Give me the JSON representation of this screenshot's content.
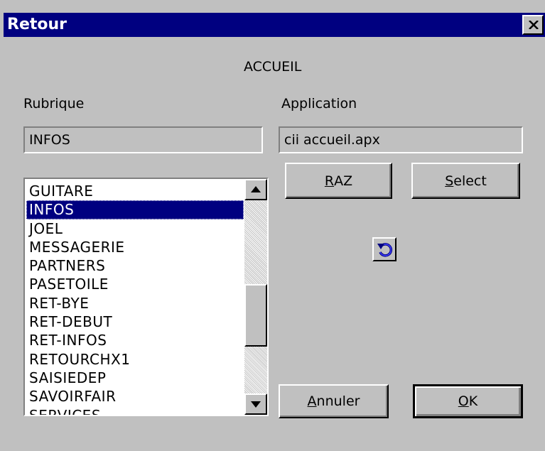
{
  "window": {
    "title": "Retour"
  },
  "heading": "ACCUEIL",
  "labels": {
    "rubrique": "Rubrique",
    "application": "Application"
  },
  "fields": {
    "rubrique_value": "INFOS",
    "application_value": "cii accueil.apx"
  },
  "buttons": {
    "raz": {
      "accel": "R",
      "rest": "AZ"
    },
    "select": {
      "accel": "S",
      "rest": "elect"
    },
    "annuler": {
      "accel": "A",
      "rest": "nnuler"
    },
    "ok": {
      "accel": "O",
      "rest": "K"
    }
  },
  "list": {
    "items": [
      "GUITARE",
      "INFOS",
      "JOEL",
      "MESSAGERIE",
      "PARTNERS",
      "PASETOILE",
      "RET-BYE",
      "RET-DEBUT",
      "RET-INFOS",
      "RETOURCHX1",
      "SAISIEDEP",
      "SAVOIRFAIR",
      "SERVICES"
    ],
    "selected_index": 1
  },
  "icons": {
    "close": "close-icon",
    "refresh": "refresh-icon",
    "scroll_up": "scroll-up-arrow-icon",
    "scroll_down": "scroll-down-arrow-icon"
  },
  "colors": {
    "titlebar": "#000080",
    "face": "#c0c0c0",
    "selection": "#000080"
  }
}
